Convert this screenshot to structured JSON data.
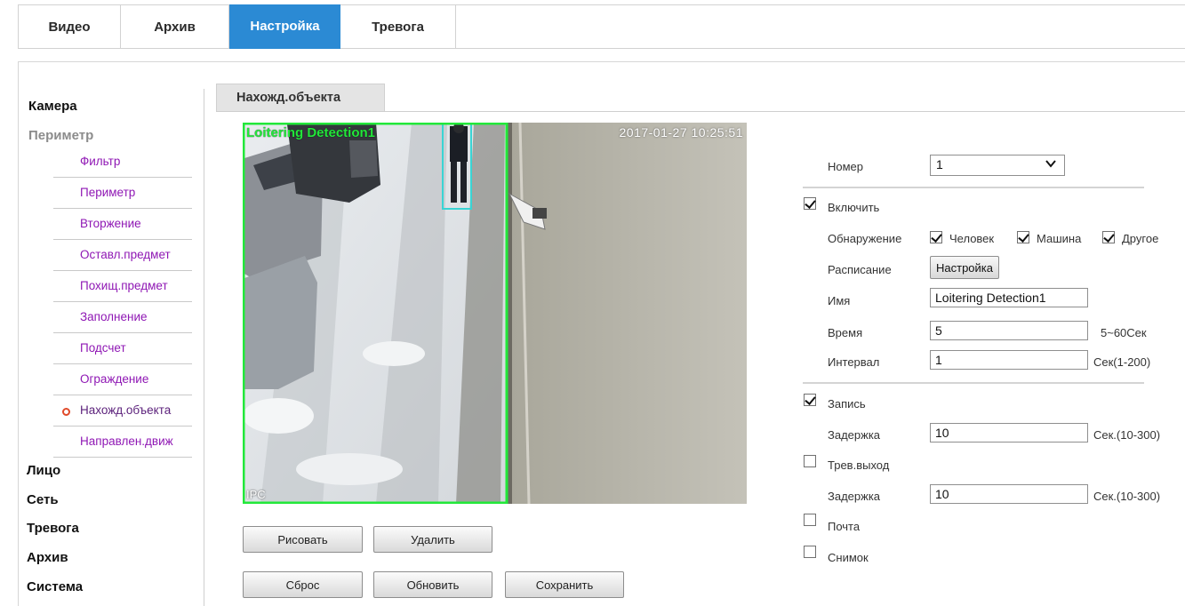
{
  "nav": {
    "tabs": [
      {
        "label": "Видео"
      },
      {
        "label": "Архив"
      },
      {
        "label": "Настройка"
      },
      {
        "label": "Тревога"
      }
    ],
    "active_tab": "Настройка"
  },
  "sidebar": {
    "categories": {
      "camera": "Камера",
      "perimeter": "Периметр",
      "face": "Лицо",
      "network": "Сеть",
      "alarm": "Тревога",
      "archive": "Архив",
      "system": "Система"
    },
    "items": [
      {
        "label": "Фильтр"
      },
      {
        "label": "Периметр"
      },
      {
        "label": "Вторжение"
      },
      {
        "label": "Оставл.предмет"
      },
      {
        "label": "Похищ.предмет"
      },
      {
        "label": "Заполнение"
      },
      {
        "label": "Подсчет"
      },
      {
        "label": "Ограждение"
      },
      {
        "label": "Нахожд.объекта"
      },
      {
        "label": "Направлен.движ"
      }
    ],
    "selected_item": "Нахожд.объекта"
  },
  "section": {
    "title": "Нахожд.объекта"
  },
  "video": {
    "rule_name": "Loitering Detection1",
    "timestamp": "2017-01-27 10:25:51",
    "ipc_label": "IPC",
    "zone_color": "#22e83a",
    "target_box_color": "#39d4d4"
  },
  "buttons": {
    "draw": "Рисовать",
    "delete": "Удалить",
    "reset": "Сброс",
    "refresh": "Обновить",
    "save": "Сохранить"
  },
  "settings": {
    "number": {
      "label": "Номер",
      "value": "1"
    },
    "enable": {
      "label": "Включить",
      "checked": true
    },
    "detection": {
      "label": "Обнаружение",
      "human": {
        "label": "Человек",
        "checked": true
      },
      "vehicle": {
        "label": "Машина",
        "checked": true
      },
      "other": {
        "label": "Другое",
        "checked": true
      }
    },
    "schedule": {
      "label": "Расписание",
      "button": "Настройка"
    },
    "name": {
      "label": "Имя",
      "value": "Loitering Detection1"
    },
    "time": {
      "label": "Время",
      "value": "5",
      "unit": "5~60Сек"
    },
    "interval": {
      "label": "Интервал",
      "value": "1",
      "unit": "Сек(1-200)"
    },
    "record": {
      "label": "Запись",
      "checked": true
    },
    "record_delay": {
      "label": "Задержка",
      "value": "10",
      "unit": "Сек.(10-300)"
    },
    "alarm_out": {
      "label": "Трев.выход",
      "checked": false
    },
    "alarm_delay": {
      "label": "Задержка",
      "value": "10",
      "unit": "Сек.(10-300)"
    },
    "email": {
      "label": "Почта",
      "checked": false
    },
    "snapshot": {
      "label": "Снимок",
      "checked": false
    }
  },
  "colors": {
    "accent": "#2b8ad4",
    "sidebar_link": "#8f17b4",
    "bullet": "#e04a2a"
  }
}
